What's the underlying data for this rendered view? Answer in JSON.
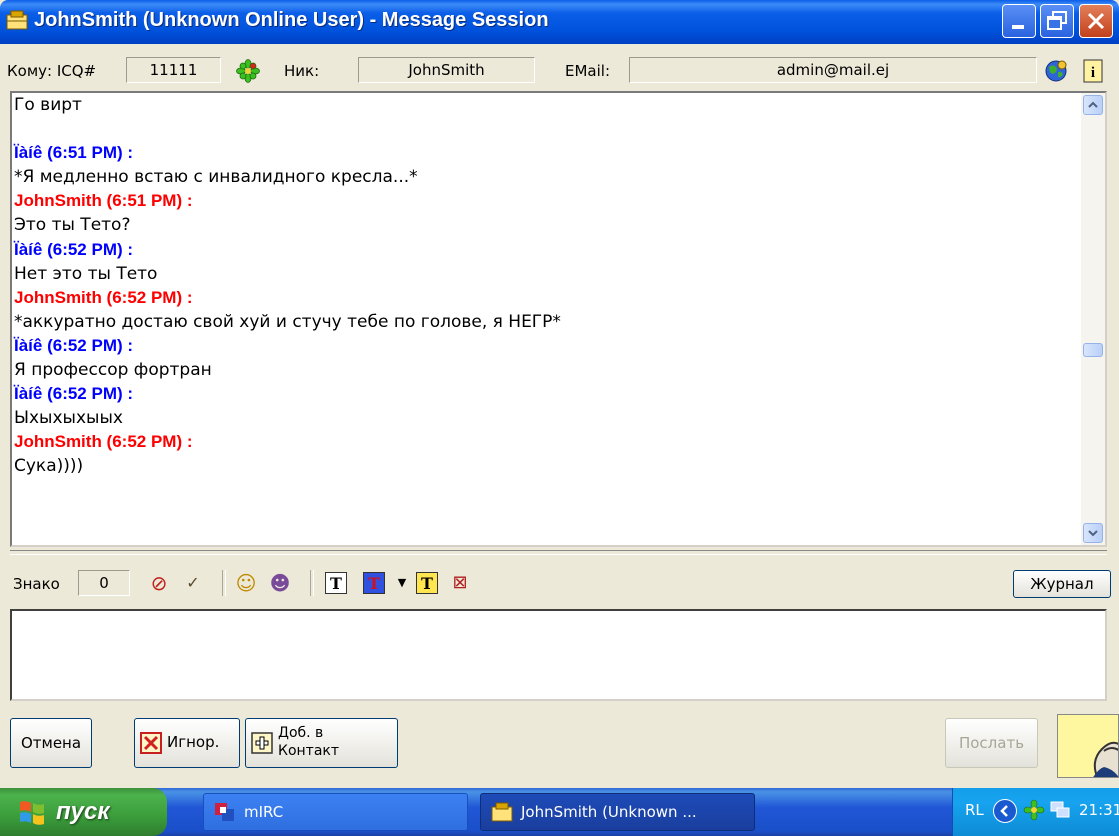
{
  "window": {
    "title": "JohnSmith (Unknown Online User) - Message Session"
  },
  "header": {
    "to_label": "Кому: ICQ#",
    "icq_number": "11111",
    "nick_label": "Ник:",
    "nick_value": "JohnSmith",
    "email_label": "EMail:",
    "email_value": "admin@mail.ej"
  },
  "chat": {
    "lines": [
      {
        "kind": "text",
        "text": "Го вирт"
      },
      {
        "kind": "text",
        "text": ""
      },
      {
        "kind": "me",
        "text": "Ïàíê (6:51 PM) :"
      },
      {
        "kind": "text",
        "text": "*Я медленно встаю с инвалидного кресла...*"
      },
      {
        "kind": "them",
        "text": "JohnSmith (6:51 PM) :"
      },
      {
        "kind": "text",
        "text": "Это ты Тето?"
      },
      {
        "kind": "me",
        "text": "Ïàíê (6:52 PM) :"
      },
      {
        "kind": "text",
        "text": "Нет это ты Тето"
      },
      {
        "kind": "them",
        "text": "JohnSmith (6:52 PM) :"
      },
      {
        "kind": "text",
        "text": "*аккуратно достаю свой хуй и стучу тебе по голове, я НЕГР*"
      },
      {
        "kind": "me",
        "text": "Ïàíê (6:52 PM) :"
      },
      {
        "kind": "text",
        "text": "Я профессор фортран"
      },
      {
        "kind": "me",
        "text": "Ïàíê (6:52 PM) :"
      },
      {
        "kind": "text",
        "text": "Ыхыхыхыых"
      },
      {
        "kind": "them",
        "text": "JohnSmith (6:52 PM) :"
      },
      {
        "kind": "text",
        "text": "Сука))))"
      }
    ]
  },
  "toolbar": {
    "chars_label": "Знако",
    "chars_count": "0",
    "journal_label": "Журнал"
  },
  "buttons": {
    "cancel": "Отмена",
    "ignore": "Игнор.",
    "add_contact_line1": "Доб. в",
    "add_contact_line2": "Контакт",
    "send": "Послать"
  },
  "taskbar": {
    "start_label": "пуск",
    "tasks": [
      "mIRC",
      "JohnSmith (Unknown ..."
    ],
    "tray_lang": "RL",
    "clock": "21:31"
  },
  "colors": {
    "own_nick": "#0000ff",
    "remote_nick": "#ff0000",
    "titlebar": "#0054e3"
  }
}
